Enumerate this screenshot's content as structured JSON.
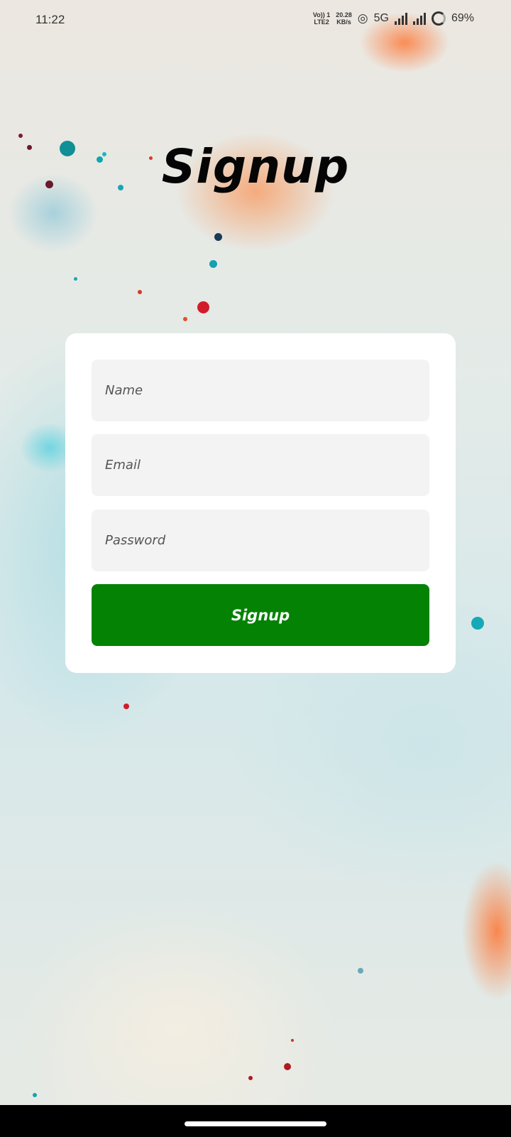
{
  "status_bar": {
    "time": "11:22",
    "volte_top": "Vo)) 1",
    "volte_bottom": "LTE2",
    "speed_top": "20.28",
    "speed_bottom": "KB/s",
    "network": "5G",
    "battery": "69%"
  },
  "title": "Signup",
  "form": {
    "name_placeholder": "Name",
    "email_placeholder": "Email",
    "password_placeholder": "Password",
    "submit_label": "Signup"
  },
  "colors": {
    "button": "#038203",
    "card": "#ffffff",
    "field": "#f3f3f3"
  }
}
